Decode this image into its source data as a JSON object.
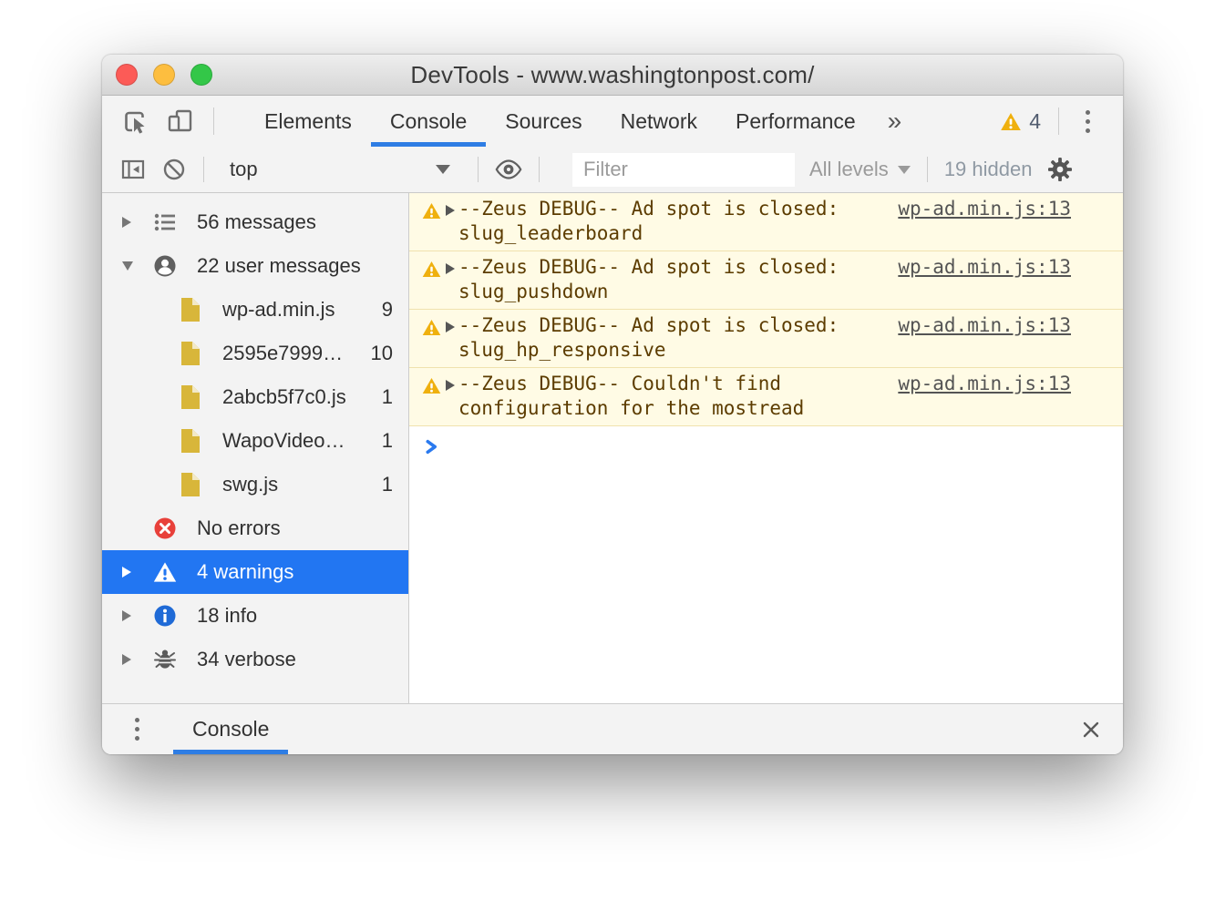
{
  "window": {
    "title": "DevTools - www.washingtonpost.com/"
  },
  "titlebar_buttons": [
    "close",
    "minimize",
    "zoom"
  ],
  "tabs": {
    "items": [
      {
        "label": "Elements"
      },
      {
        "label": "Console",
        "selected": true
      },
      {
        "label": "Sources"
      },
      {
        "label": "Network"
      },
      {
        "label": "Performance"
      }
    ],
    "more_label": "»",
    "warning_count": "4"
  },
  "toolbar": {
    "context_label": "top",
    "filter_placeholder": "Filter",
    "levels_label": "All levels",
    "hidden_label": "19 hidden"
  },
  "sidebar": {
    "items": [
      {
        "icon": "list",
        "label": "56 messages",
        "expand": "collapsed"
      },
      {
        "icon": "user",
        "label": "22 user messages",
        "expand": "expanded"
      },
      {
        "icon": "file",
        "label": "wp-ad.min.js",
        "count": "9",
        "indent": true,
        "expand": "none"
      },
      {
        "icon": "file",
        "label": "2595e7999…",
        "count": "10",
        "indent": true,
        "expand": "none"
      },
      {
        "icon": "file",
        "label": "2abcb5f7c0.js",
        "count": "1",
        "indent": true,
        "expand": "none"
      },
      {
        "icon": "file",
        "label": "WapoVideo…",
        "count": "1",
        "indent": true,
        "expand": "none"
      },
      {
        "icon": "file",
        "label": "swg.js",
        "count": "1",
        "indent": true,
        "expand": "none"
      },
      {
        "icon": "error",
        "label": "No errors",
        "expand": "none"
      },
      {
        "icon": "warning",
        "label": "4 warnings",
        "expand": "collapsed",
        "selected": true
      },
      {
        "icon": "info",
        "label": "18 info",
        "expand": "collapsed"
      },
      {
        "icon": "bug",
        "label": "34 verbose",
        "expand": "collapsed"
      }
    ]
  },
  "console": {
    "messages": [
      {
        "text": "--Zeus DEBUG-- Ad spot is closed: slug_leaderboard",
        "source": "wp-ad.min.js:13"
      },
      {
        "text": "--Zeus DEBUG-- Ad spot is closed: slug_pushdown",
        "source": "wp-ad.min.js:13"
      },
      {
        "text": "--Zeus DEBUG-- Ad spot is closed: slug_hp_responsive",
        "source": "wp-ad.min.js:13"
      },
      {
        "text": "--Zeus DEBUG-- Couldn't find configuration for the mostread",
        "source": "wp-ad.min.js:13"
      }
    ]
  },
  "bottom": {
    "tab_label": "Console"
  },
  "colors": {
    "accent_blue": "#2e7de4",
    "selection_blue": "#2276f2",
    "warning_background": "#fffbe5",
    "warning_text": "#5c3c00",
    "warning_icon": "#efb00e",
    "error_red": "#e8403a",
    "info_blue": "#1f6ad6",
    "file_gold": "#d8b63a",
    "traffic_red": "#fc5b57",
    "traffic_yellow": "#fdbe3f",
    "traffic_green": "#33c748"
  }
}
